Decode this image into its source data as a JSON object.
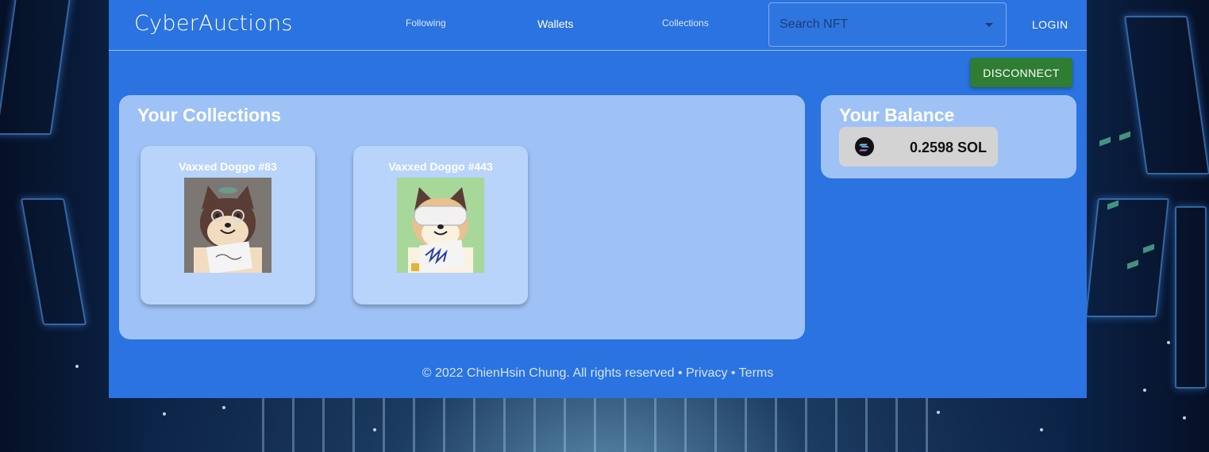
{
  "app": {
    "brand": "CyberAuctions"
  },
  "nav": {
    "links": [
      "Following",
      "Wallets",
      "Collections"
    ],
    "active": "Wallets",
    "search_placeholder": "Search NFT",
    "login_label": "LOGIN"
  },
  "actions": {
    "disconnect_label": "DISCONNECT"
  },
  "collections": {
    "title": "Your Collections",
    "items": [
      {
        "name": "Vaxxed Doggo #83",
        "image": "shiba-doggo-brown-bg-icon"
      },
      {
        "name": "Vaxxed Doggo #443",
        "image": "shiba-doggo-green-bg-icon"
      }
    ]
  },
  "balance": {
    "title": "Your Balance",
    "value": "0.2598 SOL",
    "icon": "solana-icon"
  },
  "footer": {
    "copyright": "© 2022 ChienHsin Chung. All rights reserved",
    "separator": "•",
    "privacy": "Privacy",
    "terms": "Terms"
  },
  "colors": {
    "app_bg": "#2a73e0",
    "panel_bg": "#9ec2f6",
    "card_bg": "#b8d4fb",
    "disconnect_bg": "#2e7d32"
  }
}
